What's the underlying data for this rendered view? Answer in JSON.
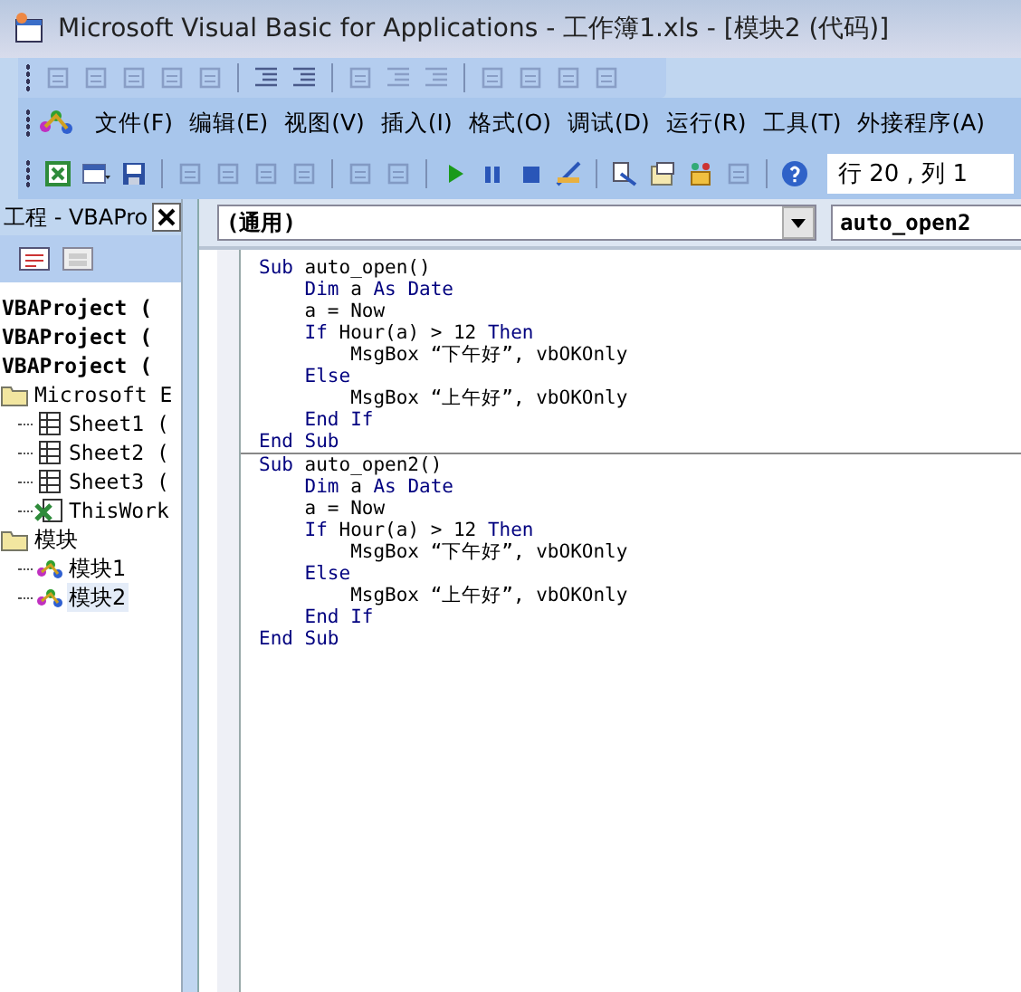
{
  "window": {
    "title": "Microsoft Visual Basic for Applications - 工作簿1.xls - [模块2 (代码)]"
  },
  "edit_toolbar": [
    {
      "kind": "list",
      "disabled": true
    },
    {
      "kind": "const",
      "disabled": true
    },
    {
      "kind": "info",
      "disabled": true
    },
    {
      "kind": "param",
      "disabled": true
    },
    {
      "kind": "word",
      "disabled": true
    },
    {
      "kind": "sep"
    },
    {
      "kind": "indent",
      "disabled": false
    },
    {
      "kind": "outdent",
      "disabled": false
    },
    {
      "kind": "sep"
    },
    {
      "kind": "hand",
      "disabled": true
    },
    {
      "kind": "comment",
      "disabled": true
    },
    {
      "kind": "uncomment",
      "disabled": true
    },
    {
      "kind": "sep"
    },
    {
      "kind": "bookmark",
      "disabled": true
    },
    {
      "kind": "bookmark",
      "disabled": true
    },
    {
      "kind": "bookmark",
      "disabled": true
    },
    {
      "kind": "bookmark",
      "disabled": true
    }
  ],
  "menu": [
    "文件(F)",
    "编辑(E)",
    "视图(V)",
    "插入(I)",
    "格式(O)",
    "调试(D)",
    "运行(R)",
    "工具(T)",
    "外接程序(A)"
  ],
  "standard_toolbar": [
    {
      "kind": "excel",
      "disabled": false
    },
    {
      "kind": "form",
      "disabled": false
    },
    {
      "kind": "save",
      "disabled": false
    },
    {
      "kind": "sep"
    },
    {
      "kind": "cut",
      "disabled": true
    },
    {
      "kind": "copy",
      "disabled": true
    },
    {
      "kind": "paste",
      "disabled": true
    },
    {
      "kind": "find",
      "disabled": true
    },
    {
      "kind": "sep"
    },
    {
      "kind": "undo",
      "disabled": true
    },
    {
      "kind": "redo",
      "disabled": true
    },
    {
      "kind": "sep"
    },
    {
      "kind": "run",
      "disabled": false
    },
    {
      "kind": "pause",
      "disabled": false
    },
    {
      "kind": "stop",
      "disabled": false
    },
    {
      "kind": "design",
      "disabled": false
    },
    {
      "kind": "sep"
    },
    {
      "kind": "project",
      "disabled": false
    },
    {
      "kind": "props",
      "disabled": false
    },
    {
      "kind": "browser",
      "disabled": false
    },
    {
      "kind": "tools",
      "disabled": true
    },
    {
      "kind": "sep"
    },
    {
      "kind": "help",
      "disabled": false
    }
  ],
  "position": "行 20 , 列 1",
  "project_pane": {
    "title": "工程 - VBAPro",
    "tree": [
      {
        "label": "VBAProject (",
        "kind": "project",
        "selected": false
      },
      {
        "label": "VBAProject (",
        "kind": "project",
        "selected": false
      },
      {
        "label": "VBAProject (",
        "kind": "project",
        "selected": false
      },
      {
        "label": "Microsoft E",
        "kind": "folder",
        "selected": false,
        "children": [
          {
            "label": "Sheet1 (",
            "kind": "sheet",
            "selected": false
          },
          {
            "label": "Sheet2 (",
            "kind": "sheet",
            "selected": false
          },
          {
            "label": "Sheet3 (",
            "kind": "sheet",
            "selected": false
          },
          {
            "label": "ThisWork",
            "kind": "workbook",
            "selected": false
          }
        ]
      },
      {
        "label": "模块",
        "kind": "folder",
        "selected": false,
        "children": [
          {
            "label": "模块1",
            "kind": "module",
            "selected": false
          },
          {
            "label": "模块2",
            "kind": "module",
            "selected": true
          }
        ]
      }
    ]
  },
  "code_window": {
    "object": "(通用)",
    "procedure": "auto_open2",
    "procedures": [
      {
        "lines": [
          [
            {
              "text": "Sub",
              "kind": "keyword"
            },
            {
              "text": " auto_open()",
              "kind": "plain"
            }
          ],
          [
            {
              "text": "    Dim",
              "kind": "keyword"
            },
            {
              "text": " a ",
              "kind": "plain"
            },
            {
              "text": "As Date",
              "kind": "keyword"
            }
          ],
          [
            {
              "text": "    a = Now",
              "kind": "plain"
            }
          ],
          [
            {
              "text": "    If",
              "kind": "keyword"
            },
            {
              "text": " Hour(a) > 12 ",
              "kind": "plain"
            },
            {
              "text": "Then",
              "kind": "keyword"
            }
          ],
          [
            {
              "text": "        MsgBox “下午好”, vbOKOnly",
              "kind": "plain"
            }
          ],
          [
            {
              "text": "    Else",
              "kind": "keyword"
            }
          ],
          [
            {
              "text": "        MsgBox “上午好”, vbOKOnly",
              "kind": "plain"
            }
          ],
          [
            {
              "text": "    End If",
              "kind": "keyword"
            }
          ],
          [
            {
              "text": "End Sub",
              "kind": "keyword"
            }
          ]
        ]
      },
      {
        "lines": [
          [
            {
              "text": "Sub",
              "kind": "keyword"
            },
            {
              "text": " auto_open2()",
              "kind": "plain"
            }
          ],
          [
            {
              "text": "    Dim",
              "kind": "keyword"
            },
            {
              "text": " a ",
              "kind": "plain"
            },
            {
              "text": "As Date",
              "kind": "keyword"
            }
          ],
          [
            {
              "text": "    a = Now",
              "kind": "plain"
            }
          ],
          [
            {
              "text": "    If",
              "kind": "keyword"
            },
            {
              "text": " Hour(a) > 12 ",
              "kind": "plain"
            },
            {
              "text": "Then",
              "kind": "keyword"
            }
          ],
          [
            {
              "text": "        MsgBox “下午好”, vbOKOnly",
              "kind": "plain"
            }
          ],
          [
            {
              "text": "    Else",
              "kind": "keyword"
            }
          ],
          [
            {
              "text": "        MsgBox “上午好”, vbOKOnly",
              "kind": "plain"
            }
          ],
          [
            {
              "text": "    End If",
              "kind": "keyword"
            }
          ],
          [
            {
              "text": "End Sub",
              "kind": "keyword"
            }
          ]
        ]
      }
    ]
  }
}
